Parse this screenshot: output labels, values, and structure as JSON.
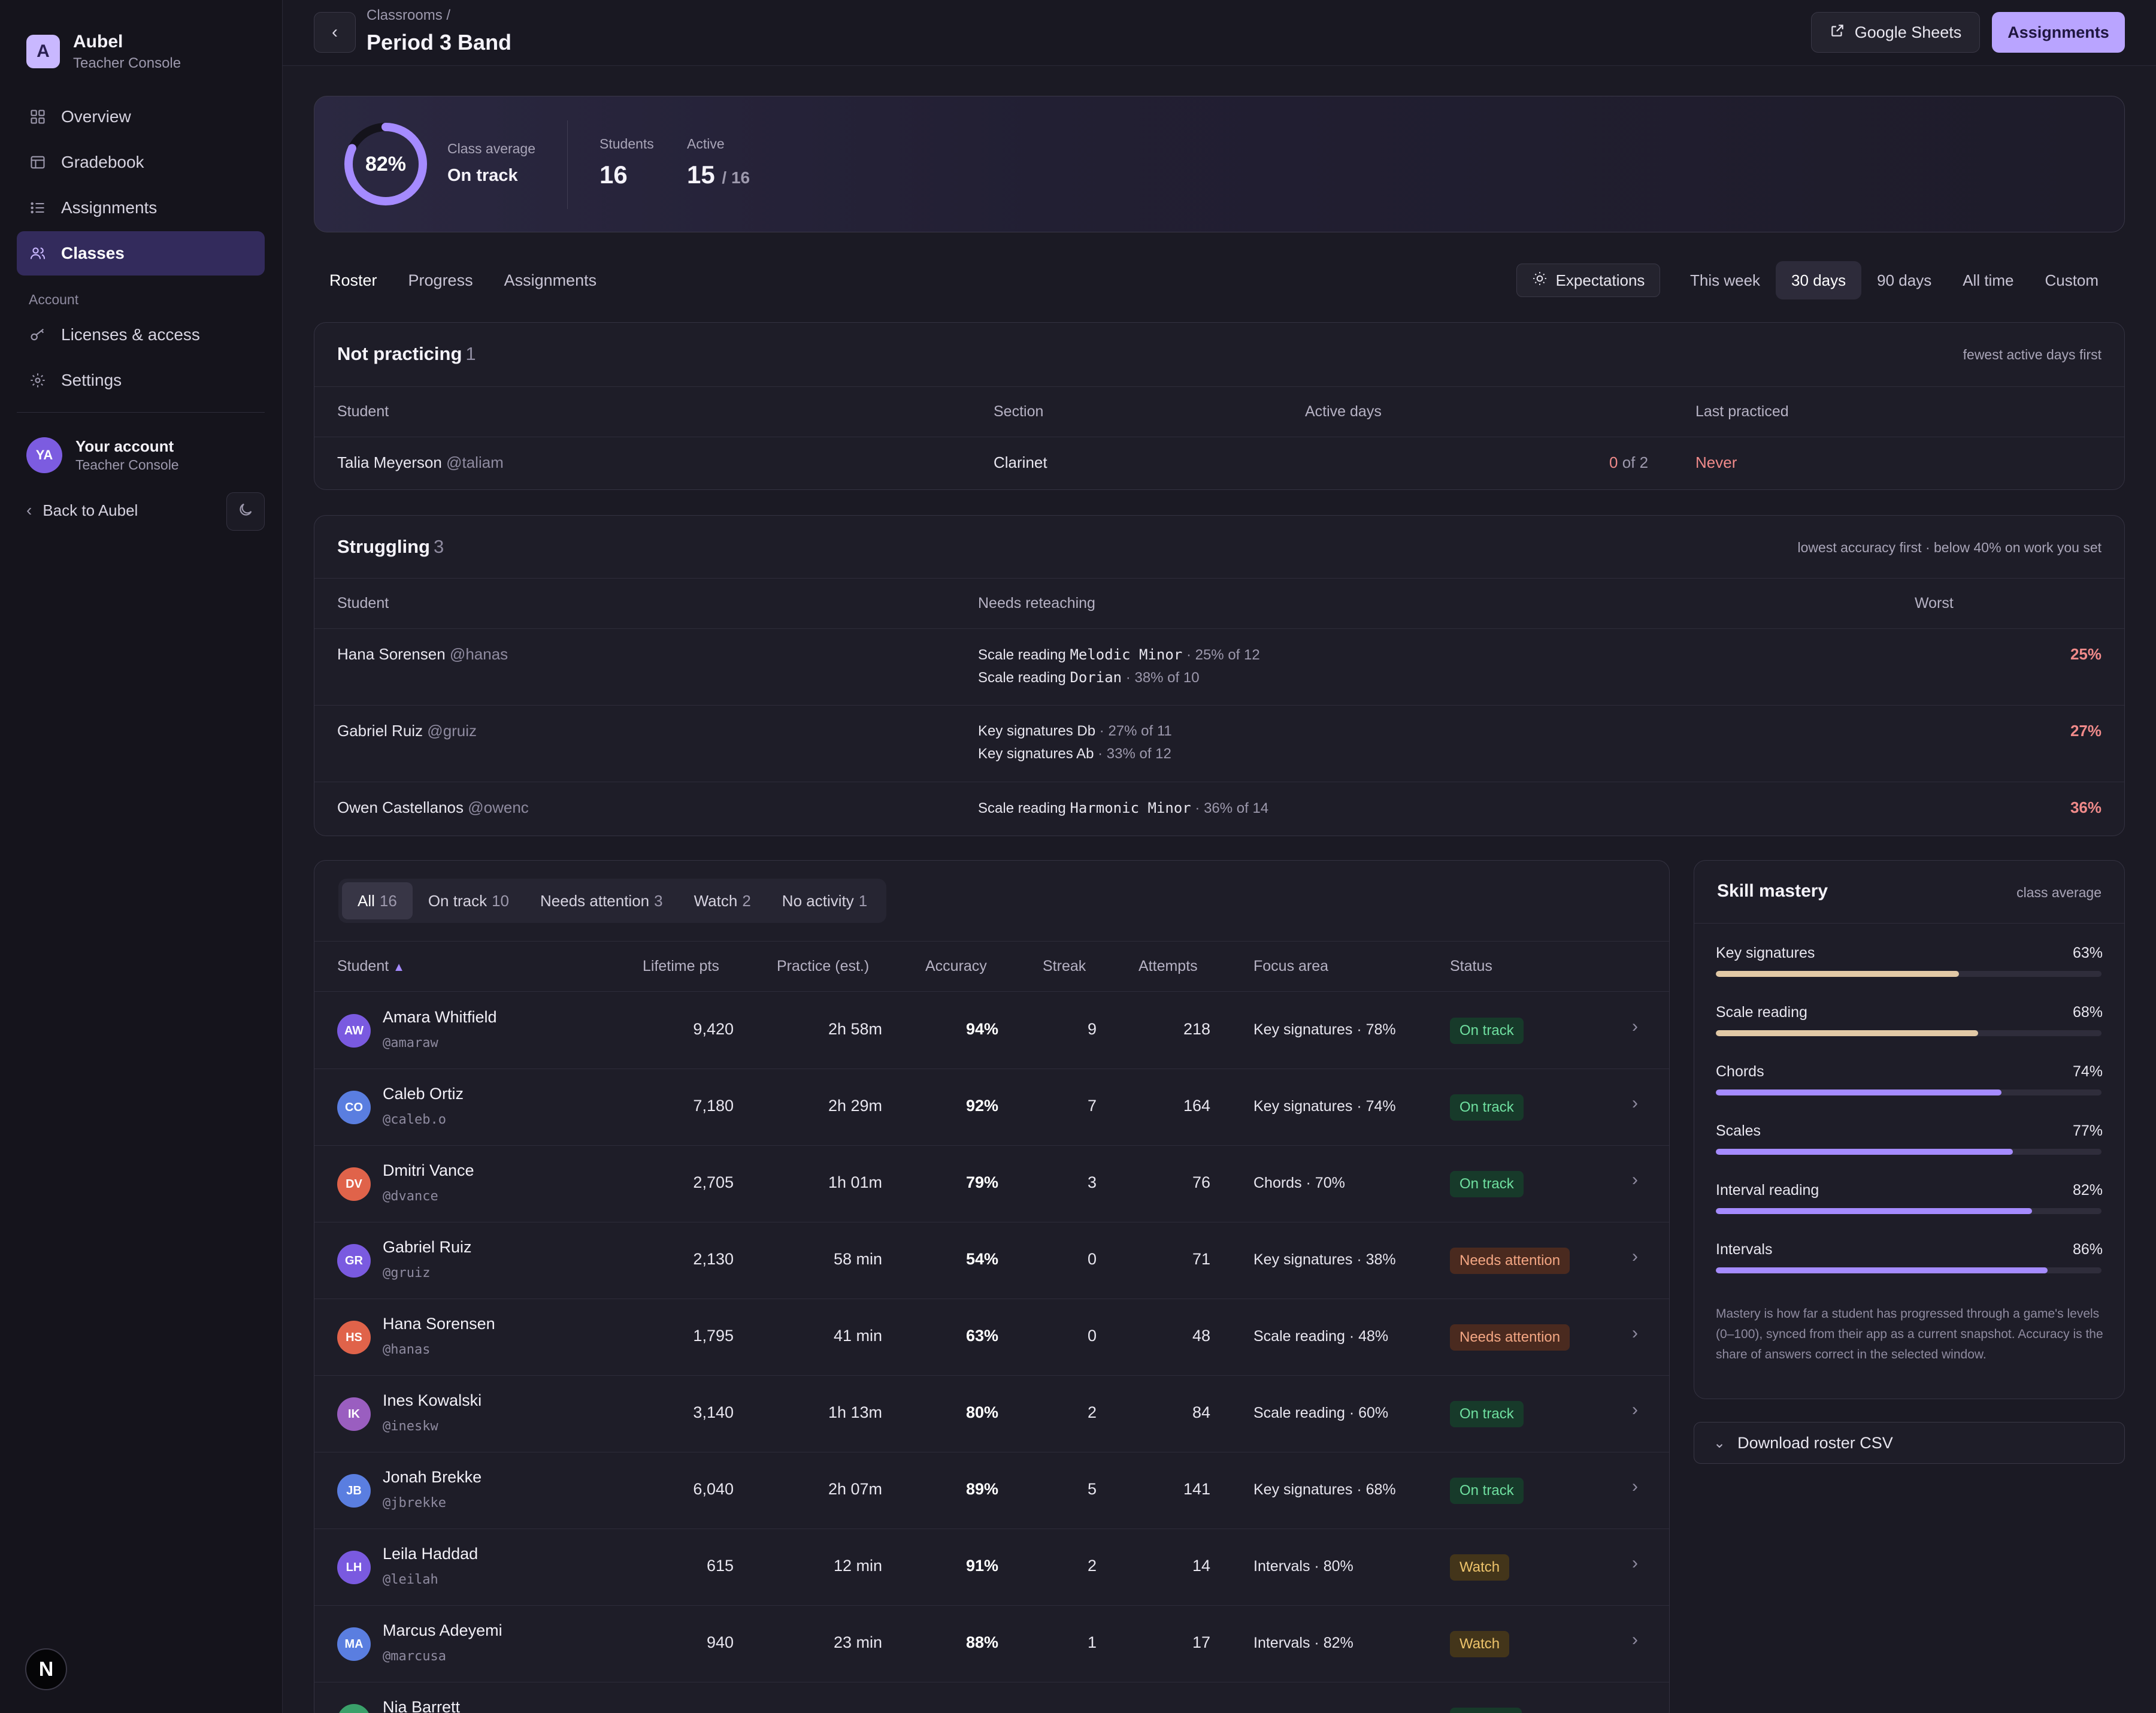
{
  "app": {
    "name": "Aubel",
    "subtitle": "Teacher Console",
    "logo_letter": "A"
  },
  "sidebar": {
    "items": [
      {
        "label": "Overview",
        "icon": "grid-icon",
        "active": false
      },
      {
        "label": "Gradebook",
        "icon": "table-icon",
        "active": false
      },
      {
        "label": "Assignments",
        "icon": "list-icon",
        "active": false
      },
      {
        "label": "Classes",
        "icon": "users-icon",
        "active": true
      }
    ],
    "account_section_label": "Account",
    "account_items": [
      {
        "label": "Licenses & access",
        "icon": "key-icon"
      },
      {
        "label": "Settings",
        "icon": "gear-icon"
      }
    ],
    "user": {
      "initials": "YA",
      "name": "Your account",
      "role": "Teacher Console"
    },
    "back_label": "Back to Aubel",
    "bottom_badge": "N"
  },
  "header": {
    "breadcrumb": "Classrooms /",
    "title": "Period 3 Band",
    "sheets_label": "Google Sheets",
    "assignments_label": "Assignments"
  },
  "summary": {
    "class_average_pct": 82,
    "class_average_text": "82%",
    "class_average_label": "Class average",
    "class_average_status": "On track",
    "students_label": "Students",
    "students_value": "16",
    "active_label": "Active",
    "active_value": "15",
    "active_of": "/ 16"
  },
  "view_tabs": [
    "Roster",
    "Progress",
    "Assignments"
  ],
  "expectations_label": "Expectations",
  "range_tabs": [
    "This week",
    "30 days",
    "90 days",
    "All time",
    "Custom"
  ],
  "not_practicing": {
    "title": "Not practicing",
    "count": "1",
    "hint": "fewest active days first",
    "headers": [
      "Student",
      "Section",
      "Active days",
      "Last practiced"
    ],
    "rows": [
      {
        "name": "Talia Meyerson",
        "handle": "@taliam",
        "section": "Clarinet",
        "active_num": "0",
        "active_of": "of 2",
        "last": "Never"
      }
    ]
  },
  "struggling": {
    "title": "Struggling",
    "count": "3",
    "hint": "lowest accuracy first · below 40% on work you set",
    "headers": [
      "Student",
      "Needs reteaching",
      "Worst"
    ],
    "rows": [
      {
        "name": "Hana Sorensen",
        "handle": "@hanas",
        "worst": "25%",
        "lines": [
          {
            "prefix": "Scale reading ",
            "mono": "Melodic Minor",
            "detail": " · 25% of 12"
          },
          {
            "prefix": "Scale reading ",
            "mono": "Dorian",
            "detail": " · 38% of 10"
          }
        ]
      },
      {
        "name": "Gabriel Ruiz",
        "handle": "@gruiz",
        "worst": "27%",
        "lines": [
          {
            "prefix": "Key signatures Db",
            "mono": "",
            "detail": " · 27% of 11"
          },
          {
            "prefix": "Key signatures Ab",
            "mono": "",
            "detail": " · 33% of 12"
          }
        ]
      },
      {
        "name": "Owen Castellanos",
        "handle": "@owenc",
        "worst": "36%",
        "lines": [
          {
            "prefix": "Scale reading ",
            "mono": "Harmonic Minor",
            "detail": " · 36% of 14"
          }
        ]
      }
    ]
  },
  "roster": {
    "filters": [
      {
        "label": "All",
        "count": "16",
        "active": true
      },
      {
        "label": "On track",
        "count": "10",
        "active": false
      },
      {
        "label": "Needs attention",
        "count": "3",
        "active": false
      },
      {
        "label": "Watch",
        "count": "2",
        "active": false
      },
      {
        "label": "No activity",
        "count": "1",
        "active": false
      }
    ],
    "headers": {
      "student": "Student",
      "sort_arrow": "▲",
      "points": "Lifetime pts",
      "practice": "Practice (est.)",
      "accuracy": "Accuracy",
      "streak": "Streak",
      "attempts": "Attempts",
      "focus": "Focus area",
      "status": "Status"
    },
    "rows": [
      {
        "initials": "AW",
        "color": "#7a5ae0",
        "name": "Amara Whitfield",
        "handle": "@amaraw",
        "points": "9,420",
        "practice": "2h 58m",
        "accuracy": "94%",
        "streak": "9",
        "attempts": "218",
        "focus": "Key signatures · 78%",
        "status": "On track",
        "status_kind": "on"
      },
      {
        "initials": "CO",
        "color": "#5a7ee0",
        "name": "Caleb Ortiz",
        "handle": "@caleb.o",
        "points": "7,180",
        "practice": "2h 29m",
        "accuracy": "92%",
        "streak": "7",
        "attempts": "164",
        "focus": "Key signatures · 74%",
        "status": "On track",
        "status_kind": "on"
      },
      {
        "initials": "DV",
        "color": "#e0634a",
        "name": "Dmitri Vance",
        "handle": "@dvance",
        "points": "2,705",
        "practice": "1h 01m",
        "accuracy": "79%",
        "streak": "3",
        "attempts": "76",
        "focus": "Chords · 70%",
        "status": "On track",
        "status_kind": "on"
      },
      {
        "initials": "GR",
        "color": "#7a5ae0",
        "name": "Gabriel Ruiz",
        "handle": "@gruiz",
        "points": "2,130",
        "practice": "58 min",
        "accuracy": "54%",
        "streak": "0",
        "attempts": "71",
        "focus": "Key signatures · 38%",
        "status": "Needs attention",
        "status_kind": "needs"
      },
      {
        "initials": "HS",
        "color": "#e0634a",
        "name": "Hana Sorensen",
        "handle": "@hanas",
        "points": "1,795",
        "practice": "41 min",
        "accuracy": "63%",
        "streak": "0",
        "attempts": "48",
        "focus": "Scale reading · 48%",
        "status": "Needs attention",
        "status_kind": "needs"
      },
      {
        "initials": "IK",
        "color": "#9a5ec0",
        "name": "Ines Kowalski",
        "handle": "@ineskw",
        "points": "3,140",
        "practice": "1h 13m",
        "accuracy": "80%",
        "streak": "2",
        "attempts": "84",
        "focus": "Scale reading · 60%",
        "status": "On track",
        "status_kind": "on"
      },
      {
        "initials": "JB",
        "color": "#5a7ee0",
        "name": "Jonah Brekke",
        "handle": "@jbrekke",
        "points": "6,040",
        "practice": "2h 07m",
        "accuracy": "89%",
        "streak": "5",
        "attempts": "141",
        "focus": "Key signatures · 68%",
        "status": "On track",
        "status_kind": "on"
      },
      {
        "initials": "LH",
        "color": "#7a5ae0",
        "name": "Leila Haddad",
        "handle": "@leilah",
        "points": "615",
        "practice": "12 min",
        "accuracy": "91%",
        "streak": "2",
        "attempts": "14",
        "focus": "Intervals · 80%",
        "status": "Watch",
        "status_kind": "watch"
      },
      {
        "initials": "MA",
        "color": "#5a7ee0",
        "name": "Marcus Adeyemi",
        "handle": "@marcusa",
        "points": "940",
        "practice": "23 min",
        "accuracy": "88%",
        "streak": "1",
        "attempts": "17",
        "focus": "Intervals · 82%",
        "status": "Watch",
        "status_kind": "watch"
      },
      {
        "initials": "NB",
        "color": "#3aa06a",
        "name": "Nia Barrett",
        "handle": "",
        "points": "",
        "practice": "",
        "accuracy": "",
        "streak": "",
        "attempts": "",
        "focus": "",
        "status": "",
        "status_kind": "on"
      }
    ]
  },
  "skill_mastery": {
    "title": "Skill mastery",
    "hint": "class average",
    "skills": [
      {
        "label": "Key signatures",
        "value": 63,
        "text": "63%",
        "color": "#e2c9a6"
      },
      {
        "label": "Scale reading",
        "value": 68,
        "text": "68%",
        "color": "#e2c9a6"
      },
      {
        "label": "Chords",
        "value": 74,
        "text": "74%",
        "color": "#a58bff"
      },
      {
        "label": "Scales",
        "value": 77,
        "text": "77%",
        "color": "#a58bff"
      },
      {
        "label": "Interval reading",
        "value": 82,
        "text": "82%",
        "color": "#a58bff"
      },
      {
        "label": "Intervals",
        "value": 86,
        "text": "86%",
        "color": "#a58bff"
      }
    ],
    "note": "Mastery is how far a student has progressed through a game's levels (0–100), synced from their app as a current snapshot. Accuracy is the share of answers correct in the selected window."
  },
  "download_label": "Download roster CSV"
}
